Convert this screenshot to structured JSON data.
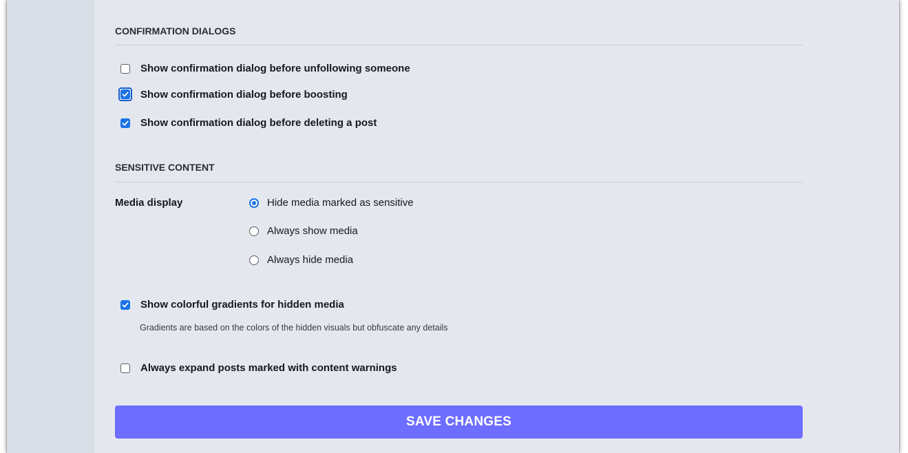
{
  "sections": {
    "confirmation_dialogs": {
      "title": "CONFIRMATION DIALOGS",
      "options": [
        {
          "label": "Show confirmation dialog before unfollowing someone",
          "checked": false
        },
        {
          "label": "Show confirmation dialog before boosting",
          "checked": true,
          "focused": true
        },
        {
          "label": "Show confirmation dialog before deleting a post",
          "checked": true
        }
      ]
    },
    "sensitive_content": {
      "title": "SENSITIVE CONTENT",
      "media_display": {
        "label": "Media display",
        "selected": "Hide media marked as sensitive",
        "options": [
          {
            "label": "Hide media marked as sensitive",
            "selected": true
          },
          {
            "label": "Always show media",
            "selected": false
          },
          {
            "label": "Always hide media",
            "selected": false
          }
        ]
      },
      "gradients": {
        "label": "Show colorful gradients for hidden media",
        "checked": true,
        "hint": "Gradients are based on the colors of the hidden visuals but obfuscate any details"
      },
      "expand_cw": {
        "label": "Always expand posts marked with content warnings",
        "checked": false
      }
    }
  },
  "save_button": {
    "label": "SAVE CHANGES"
  },
  "colors": {
    "accent": "#1a73e8",
    "button": "#6d6dff",
    "background": "#e4e8ee",
    "sidebar": "#d9dfe7"
  },
  "icons": {
    "checkmark": "check-icon"
  }
}
